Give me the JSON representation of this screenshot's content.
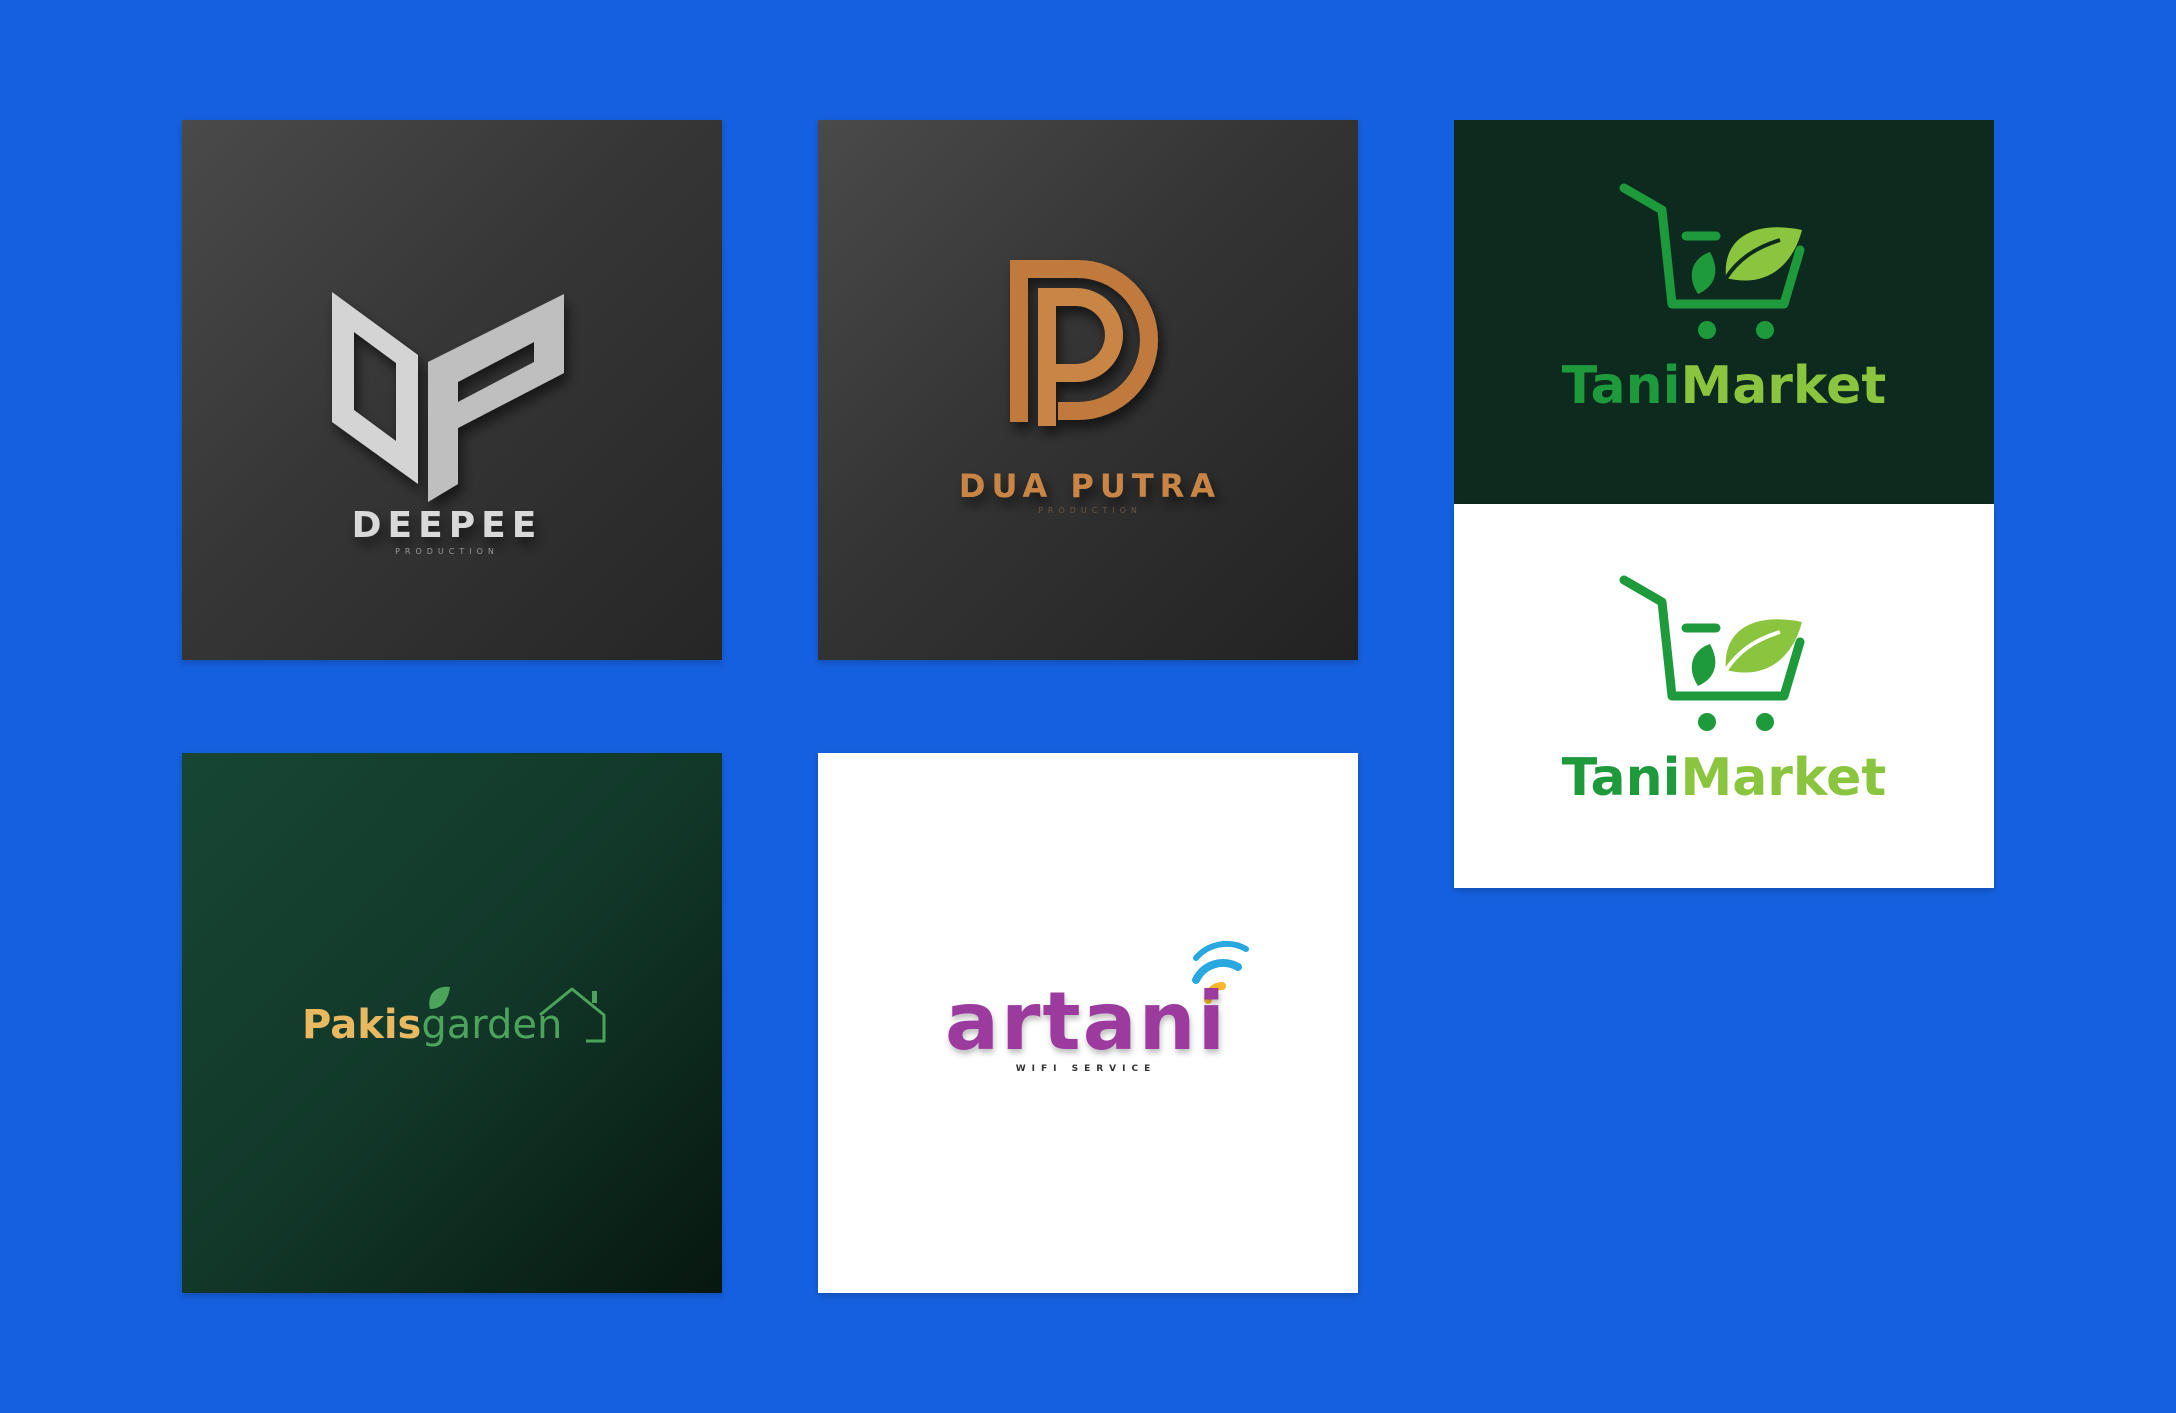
{
  "page": {
    "background_color": "#1560DE"
  },
  "logos": {
    "deepee": {
      "name": "DEEPEE",
      "tagline": "PRODUCTION",
      "colors": {
        "mark": "#D6D6D6",
        "text": "#D9D9D9",
        "background": "#3A3A3A"
      }
    },
    "dua_putra": {
      "name": "DUA PUTRA",
      "tagline": "PRODUCTION",
      "colors": {
        "mark": "#C07A3E",
        "text": "#C98545",
        "background": "#343434"
      }
    },
    "tani_market_dark": {
      "name_part1": "Tani",
      "name_part2": "Market",
      "icon": "shopping-cart-leaf-icon",
      "colors": {
        "part1": "#1E9A3C",
        "part2": "#8BC53F",
        "background": "#0C2A1E"
      }
    },
    "tani_market_light": {
      "name_part1": "Tani",
      "name_part2": "Market",
      "icon": "shopping-cart-leaf-icon",
      "colors": {
        "part1": "#1E9A3C",
        "part2": "#8BC53F",
        "background": "#FFFFFF"
      }
    },
    "pakis_garden": {
      "name_part1": "Pakis",
      "name_part2": "garden",
      "icon": "leaf-house-icon",
      "colors": {
        "part1": "#E8B960",
        "part2": "#4CA35C",
        "background": "#164232"
      }
    },
    "artani": {
      "name": "artani",
      "tagline": "WIFI SERVICE",
      "icon": "wifi-signal-icon",
      "colors": {
        "text": "#9B3A9E",
        "wifi_inner": "#F5B62A",
        "wifi_outer": "#29A8E0",
        "background": "#FFFFFF"
      }
    }
  }
}
